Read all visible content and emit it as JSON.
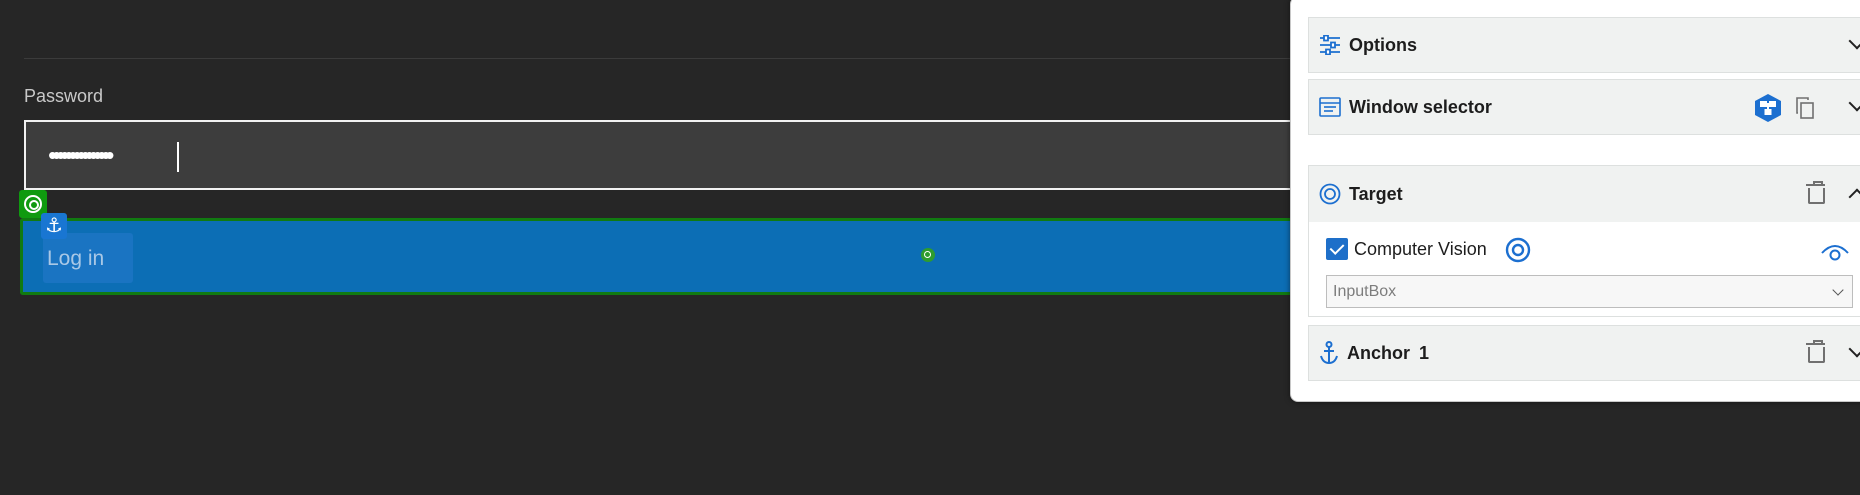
{
  "form": {
    "password_label": "Password",
    "password_value": "•••••••••••••••",
    "login_label": "Log in"
  },
  "panel": {
    "options": {
      "title": "Options"
    },
    "window_selector": {
      "title": "Window selector"
    },
    "target": {
      "title": "Target",
      "computer_vision_label": "Computer Vision",
      "computer_vision_checked": true,
      "element_type_value": "InputBox"
    },
    "anchor": {
      "title": "Anchor",
      "count": "1"
    }
  },
  "colors": {
    "accent": "#1c6fd0",
    "button": "#0c6eb5",
    "target_green": "#0f9a0f"
  },
  "icons": [
    "sliders-icon",
    "window-icon",
    "tree-icon",
    "copy-icon",
    "target-icon",
    "trash-icon",
    "anchor-icon",
    "eye-icon",
    "chevron-down-icon",
    "chevron-up-icon"
  ]
}
